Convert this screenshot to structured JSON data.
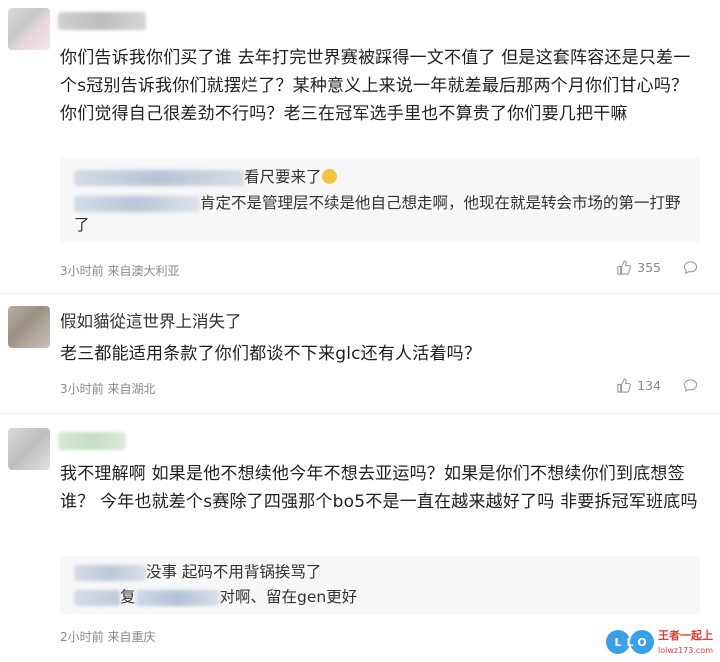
{
  "comments": [
    {
      "text": "你们告诉我你们买了谁 去年打完世界赛被踩得一文不值了 但是这套阵容还是只差一个s冠别告诉我你们就摆烂了？某种意义上来说一年就差最后那两个月你们甘心吗？你们觉得自己很差劲不行吗？老三在冠军选手里也不算贵了你们要几把干嘛",
      "replies": [
        {
          "text": "看尺要来了"
        },
        {
          "text": "肯定不是管理层不续是他自己想走啊，他现在就是转会市场的第一打野了"
        }
      ],
      "time": "3小时前",
      "location": "来自澳大利亚",
      "likes": "355"
    },
    {
      "author": "假如貓從這世界上消失了",
      "text": "老三都能适用条款了你们都谈不下来glc还有人活着吗？",
      "time": "3小时前",
      "location": "来自湖北",
      "likes": "134"
    },
    {
      "text": "我不理解啊 如果是他不想续他今年不想去亚运吗？如果是你们不想续你们到底想签谁？ 今年也就差个s赛除了四强那个bo5不是一直在越来越好了吗 非要拆冠军班底吗",
      "replies": [
        {
          "text": "没事 起码不用背锅挨骂了"
        },
        {
          "prefix": "复",
          "text": "对啊、留在gen更好"
        }
      ],
      "time": "2小时前",
      "location": "来自重庆"
    }
  ],
  "icons": {
    "like": "thumbs-up-icon",
    "comment": "comment-bubble-icon",
    "emoji": "grinning-emoji-icon"
  },
  "watermark": {
    "brand": "LOL",
    "site": "lolwz173.com",
    "tag": "王者一起上"
  }
}
